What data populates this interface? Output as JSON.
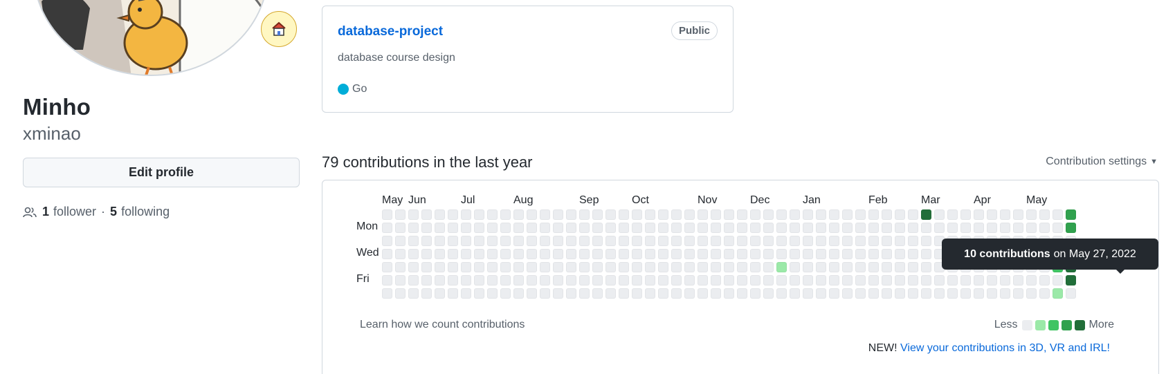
{
  "profile": {
    "name": "Minho",
    "login": "xminao",
    "edit_label": "Edit profile",
    "followers": "1",
    "followers_label": "follower",
    "separator": "·",
    "following": "5",
    "following_label": "following",
    "status_icon": "house-emoji"
  },
  "repo": {
    "name": "database-project",
    "visibility": "Public",
    "description": "database course design",
    "language": "Go",
    "language_color": "#00ADD8"
  },
  "contributions": {
    "title": "79 contributions in the last year",
    "settings_label": "Contribution settings",
    "months": [
      "May",
      "Jun",
      "Jul",
      "Aug",
      "Sep",
      "Oct",
      "Nov",
      "Dec",
      "Jan",
      "Feb",
      "Mar",
      "Apr",
      "May"
    ],
    "day_labels": [
      "Mon",
      "Wed",
      "Fri"
    ],
    "weeks": 53,
    "active_days": [
      {
        "week": 41,
        "day": 0,
        "level": 4
      },
      {
        "week": 30,
        "day": 4,
        "level": 1
      },
      {
        "week": 51,
        "day": 4,
        "level": 2
      },
      {
        "week": 51,
        "day": 6,
        "level": 1
      },
      {
        "week": 52,
        "day": 0,
        "level": 3
      },
      {
        "week": 52,
        "day": 1,
        "level": 3
      },
      {
        "week": 52,
        "day": 4,
        "level": 4
      },
      {
        "week": 52,
        "day": 5,
        "level": 4
      }
    ],
    "level_colors": [
      "#ebedf0",
      "#9be9a8",
      "#40c463",
      "#30a14e",
      "#216e39"
    ],
    "learn_label": "Learn how we count contributions",
    "legend_less": "Less",
    "legend_more": "More",
    "promo_prefix": "NEW!",
    "promo_link": "View your contributions in 3D, VR and IRL!",
    "tooltip_strong": "10 contributions",
    "tooltip_rest": "on May 27, 2022"
  }
}
